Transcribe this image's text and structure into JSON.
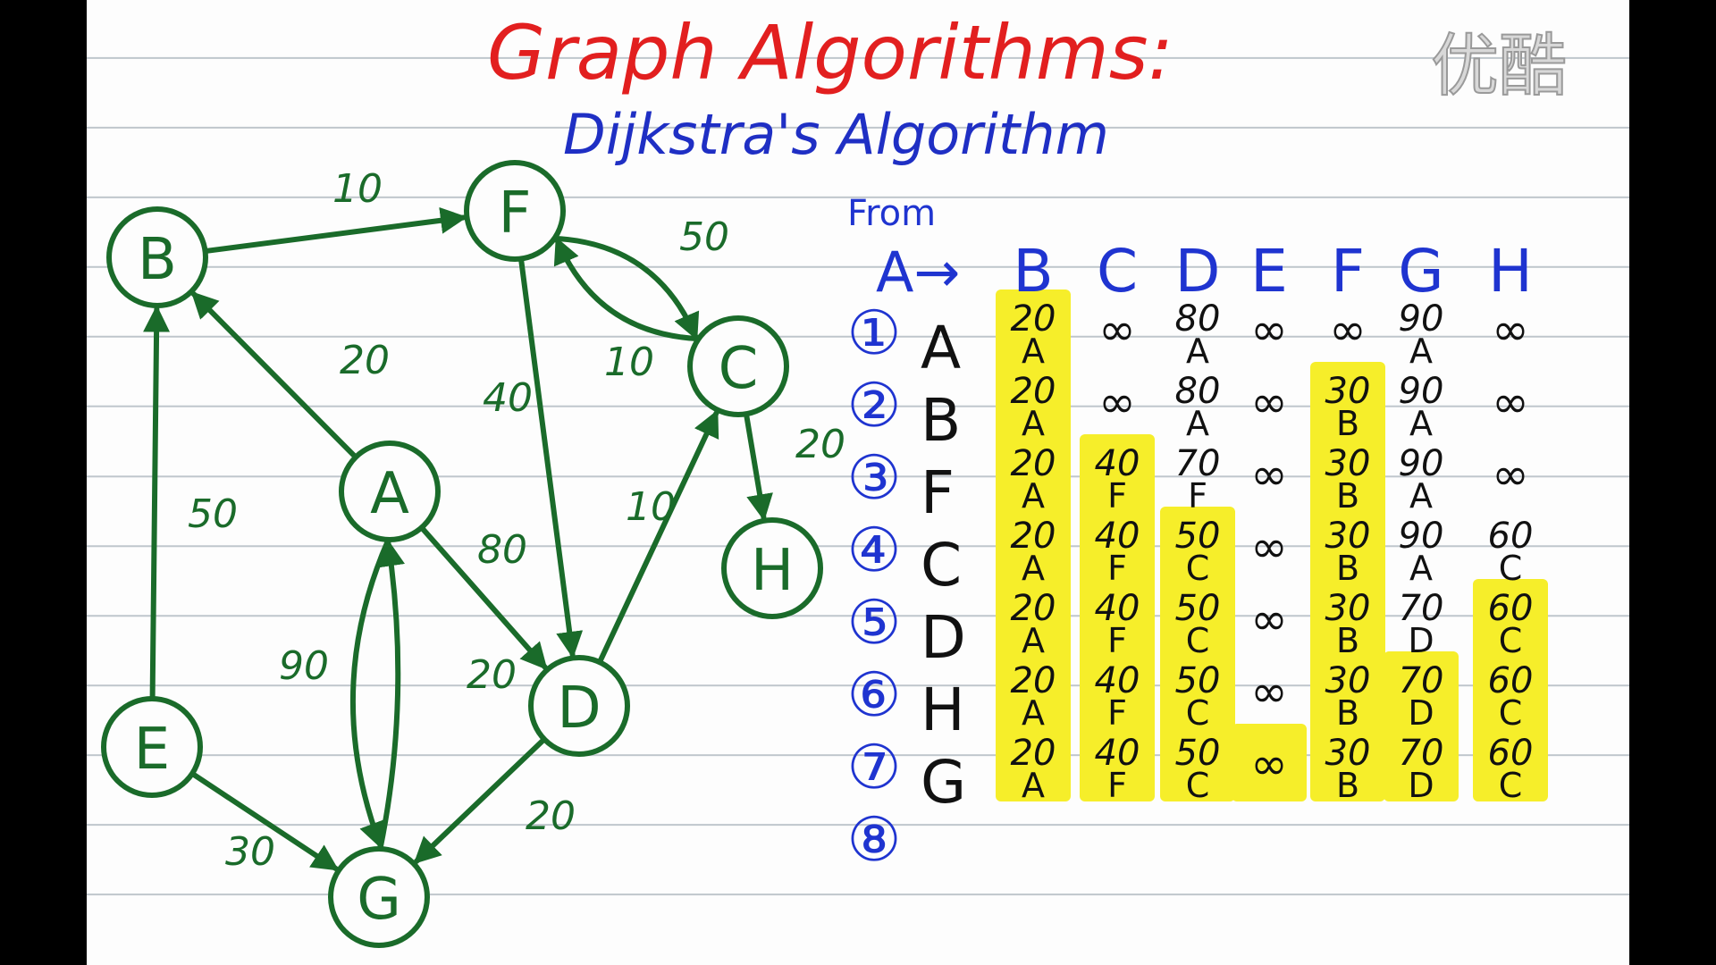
{
  "title": "Graph Algorithms:",
  "subtitle": "Dijkstra's Algorithm",
  "watermark": "优酷",
  "colors": {
    "title": "#e21f1f",
    "subtitle": "#1f2fc4",
    "graph": "#1a6b2a",
    "table_header": "#1f34d0",
    "table_text": "#111111",
    "highlight": "#f6ee2a",
    "ruling": "#bfc6cc"
  },
  "graph": {
    "nodes": [
      "B",
      "F",
      "C",
      "A",
      "H",
      "E",
      "D",
      "G"
    ],
    "edges": [
      {
        "from": "B",
        "to": "F",
        "weight": "10"
      },
      {
        "from": "C",
        "to": "F",
        "weight": "50"
      },
      {
        "from": "F",
        "to": "C",
        "weight": "10"
      },
      {
        "from": "A",
        "to": "B",
        "weight": "20"
      },
      {
        "from": "F",
        "to": "D",
        "weight": "40"
      },
      {
        "from": "C",
        "to": "H",
        "weight": "20"
      },
      {
        "from": "E",
        "to": "B",
        "weight": "50"
      },
      {
        "from": "D",
        "to": "C",
        "weight": "10"
      },
      {
        "from": "A",
        "to": "D",
        "weight": "80"
      },
      {
        "from": "A",
        "to": "G",
        "weight": "90"
      },
      {
        "from": "G",
        "to": "A",
        "weight": "20"
      },
      {
        "from": "D",
        "to": "G",
        "weight": "20"
      },
      {
        "from": "E",
        "to": "G",
        "weight": "30"
      }
    ]
  },
  "table": {
    "from_label": "From",
    "source_label": "A→",
    "columns": [
      "B",
      "C",
      "D",
      "E",
      "F",
      "G",
      "H"
    ],
    "steps": [
      "①",
      "②",
      "③",
      "④",
      "⑤",
      "⑥",
      "⑦",
      "⑧"
    ],
    "visited": [
      "A",
      "B",
      "F",
      "C",
      "D",
      "H",
      "G"
    ],
    "rows": [
      [
        [
          "20",
          "A"
        ],
        [
          "∞",
          ""
        ],
        [
          "80",
          "A"
        ],
        [
          "∞",
          ""
        ],
        [
          "∞",
          ""
        ],
        [
          "90",
          "A"
        ],
        [
          "∞",
          ""
        ]
      ],
      [
        [
          "20",
          "A"
        ],
        [
          "∞",
          ""
        ],
        [
          "80",
          "A"
        ],
        [
          "∞",
          ""
        ],
        [
          "30",
          "B"
        ],
        [
          "90",
          "A"
        ],
        [
          "∞",
          ""
        ]
      ],
      [
        [
          "20",
          "A"
        ],
        [
          "40",
          "F"
        ],
        [
          "70",
          "F"
        ],
        [
          "∞",
          ""
        ],
        [
          "30",
          "B"
        ],
        [
          "90",
          "A"
        ],
        [
          "∞",
          ""
        ]
      ],
      [
        [
          "20",
          "A"
        ],
        [
          "40",
          "F"
        ],
        [
          "50",
          "C"
        ],
        [
          "∞",
          ""
        ],
        [
          "30",
          "B"
        ],
        [
          "90",
          "A"
        ],
        [
          "60",
          "C"
        ]
      ],
      [
        [
          "20",
          "A"
        ],
        [
          "40",
          "F"
        ],
        [
          "50",
          "C"
        ],
        [
          "∞",
          ""
        ],
        [
          "30",
          "B"
        ],
        [
          "70",
          "D"
        ],
        [
          "60",
          "C"
        ]
      ],
      [
        [
          "20",
          "A"
        ],
        [
          "40",
          "F"
        ],
        [
          "50",
          "C"
        ],
        [
          "∞",
          ""
        ],
        [
          "30",
          "B"
        ],
        [
          "70",
          "D"
        ],
        [
          "60",
          "C"
        ]
      ],
      [
        [
          "20",
          "A"
        ],
        [
          "40",
          "F"
        ],
        [
          "50",
          "C"
        ],
        [
          "∞",
          ""
        ],
        [
          "30",
          "B"
        ],
        [
          "70",
          "D"
        ],
        [
          "60",
          "C"
        ]
      ]
    ]
  }
}
